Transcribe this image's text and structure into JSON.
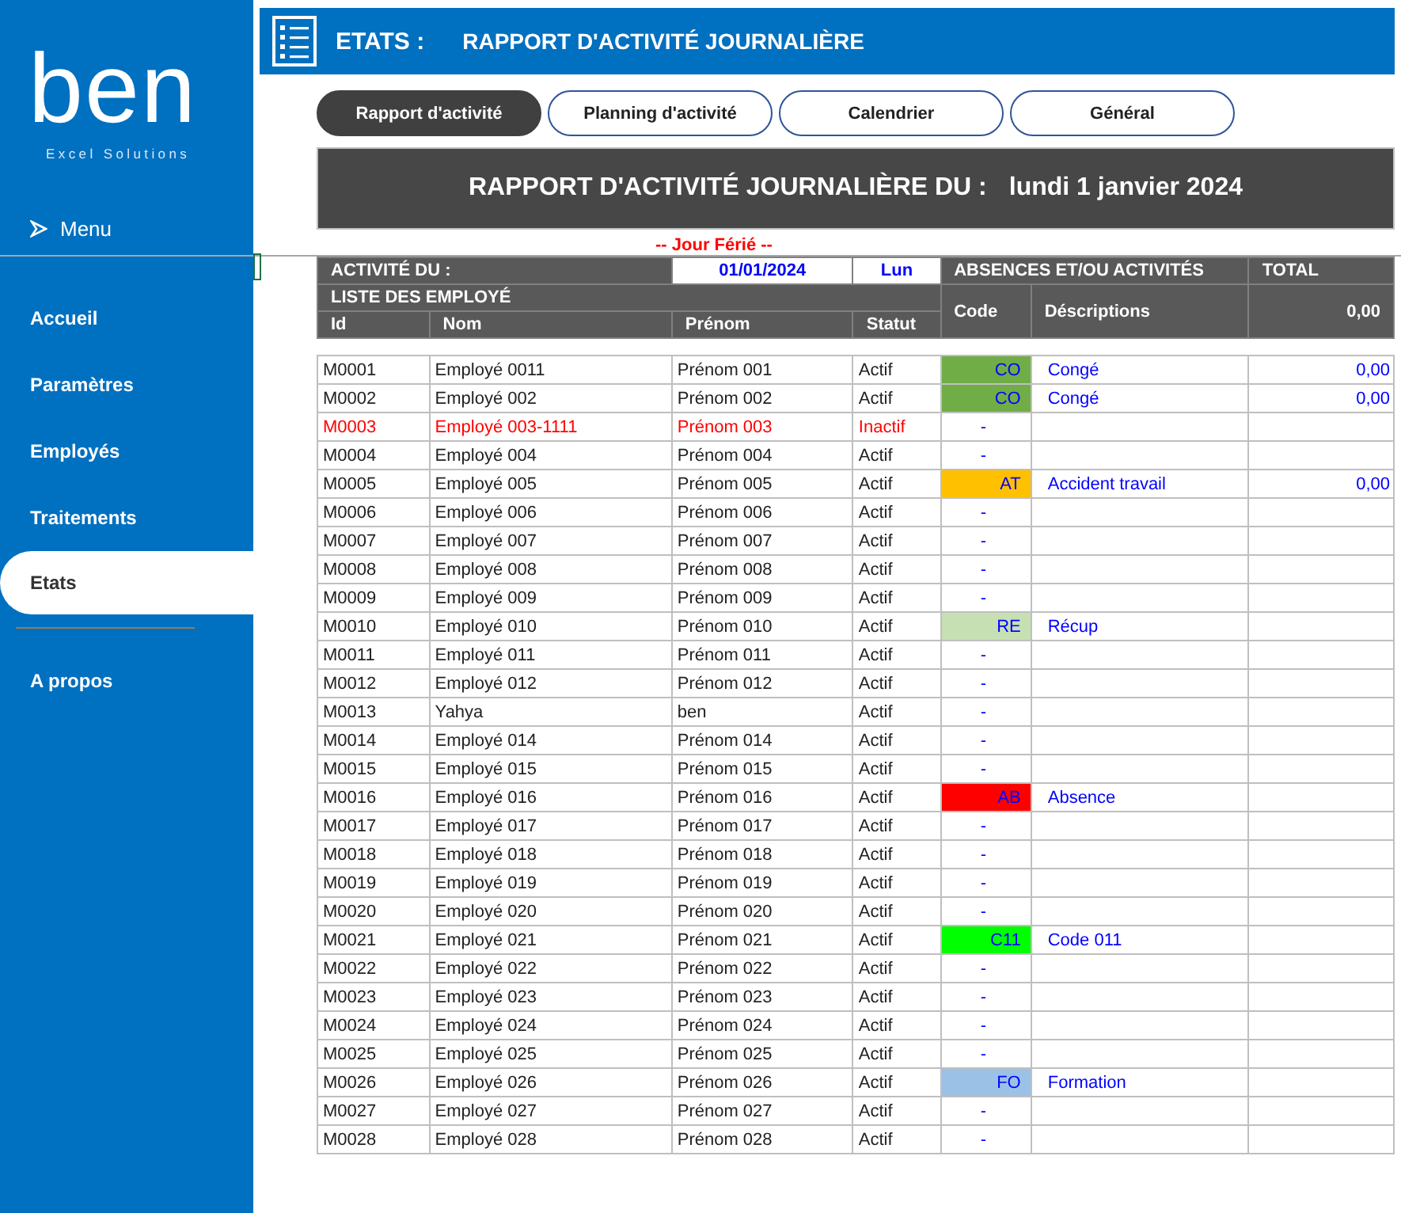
{
  "sidebar": {
    "logo": "ben",
    "tagline": "Excel Solutions",
    "menu_label": "Menu",
    "items": [
      {
        "label": "Accueil",
        "selected": false
      },
      {
        "label": "Paramètres",
        "selected": false
      },
      {
        "label": "Employés",
        "selected": false
      },
      {
        "label": "Traitements",
        "selected": false
      },
      {
        "label": "Etats",
        "selected": true
      },
      {
        "label": "A propos",
        "selected": false
      }
    ]
  },
  "header": {
    "section": "ETATS :",
    "title": "RAPPORT D'ACTIVITÉ JOURNALIÈRE"
  },
  "tabs": [
    {
      "label": "Rapport d'activité",
      "selected": true
    },
    {
      "label": "Planning d'activité",
      "selected": false
    },
    {
      "label": "Calendrier",
      "selected": false
    },
    {
      "label": "Général",
      "selected": false
    }
  ],
  "banner": {
    "label": "RAPPORT D'ACTIVITÉ JOURNALIÈRE DU :",
    "date": "lundi 1 janvier 2024"
  },
  "report": {
    "holiday_note": "-- Jour Férié --",
    "activity_label": "ACTIVITÉ DU :",
    "date": "01/01/2024",
    "day": "Lun",
    "employees_label": "LISTE DES EMPLOYÉ",
    "absences_label": "ABSENCES ET/OU ACTIVITÉS",
    "total_label": "TOTAL",
    "total": "0,00",
    "columns": [
      "Id",
      "Nom",
      "Prénom",
      "Statut",
      "Code",
      "Déscriptions"
    ]
  },
  "rows": [
    {
      "id": "M0001",
      "nom": "Employé 0011",
      "prenom": "Prénom 001",
      "statut": "Actif",
      "inactive": false,
      "code": "CO",
      "color": "#70ad47",
      "description": "Congé",
      "total": "0,00"
    },
    {
      "id": "M0002",
      "nom": "Employé 002",
      "prenom": "Prénom 002",
      "statut": "Actif",
      "inactive": false,
      "code": "CO",
      "color": "#70ad47",
      "description": "Congé",
      "total": "0,00"
    },
    {
      "id": "M0003",
      "nom": "Employé 003-1111",
      "prenom": "Prénom 003",
      "statut": "Inactif",
      "inactive": true,
      "code": "-"
    },
    {
      "id": "M0004",
      "nom": "Employé 004",
      "prenom": "Prénom 004",
      "statut": "Actif",
      "inactive": false,
      "code": "-"
    },
    {
      "id": "M0005",
      "nom": "Employé 005",
      "prenom": "Prénom 005",
      "statut": "Actif",
      "inactive": false,
      "code": "AT",
      "color": "#ffc000",
      "description": "Accident travail",
      "total": "0,00"
    },
    {
      "id": "M0006",
      "nom": "Employé 006",
      "prenom": "Prénom 006",
      "statut": "Actif",
      "inactive": false,
      "code": "-"
    },
    {
      "id": "M0007",
      "nom": "Employé 007",
      "prenom": "Prénom 007",
      "statut": "Actif",
      "inactive": false,
      "code": "-"
    },
    {
      "id": "M0008",
      "nom": "Employé 008",
      "prenom": "Prénom 008",
      "statut": "Actif",
      "inactive": false,
      "code": "-"
    },
    {
      "id": "M0009",
      "nom": "Employé 009",
      "prenom": "Prénom 009",
      "statut": "Actif",
      "inactive": false,
      "code": "-"
    },
    {
      "id": "M0010",
      "nom": "Employé 010",
      "prenom": "Prénom 010",
      "statut": "Actif",
      "inactive": false,
      "code": "RE",
      "color": "#c6e0b4",
      "description": "Récup"
    },
    {
      "id": "M0011",
      "nom": "Employé 011",
      "prenom": "Prénom 011",
      "statut": "Actif",
      "inactive": false,
      "code": "-"
    },
    {
      "id": "M0012",
      "nom": "Employé 012",
      "prenom": "Prénom 012",
      "statut": "Actif",
      "inactive": false,
      "code": "-"
    },
    {
      "id": "M0013",
      "nom": "Yahya",
      "prenom": "ben",
      "statut": "Actif",
      "inactive": false,
      "code": "-"
    },
    {
      "id": "M0014",
      "nom": "Employé 014",
      "prenom": "Prénom 014",
      "statut": "Actif",
      "inactive": false,
      "code": "-"
    },
    {
      "id": "M0015",
      "nom": "Employé 015",
      "prenom": "Prénom 015",
      "statut": "Actif",
      "inactive": false,
      "code": "-"
    },
    {
      "id": "M0016",
      "nom": "Employé 016",
      "prenom": "Prénom 016",
      "statut": "Actif",
      "inactive": false,
      "code": "AB",
      "color": "#ff0000",
      "description": "Absence"
    },
    {
      "id": "M0017",
      "nom": "Employé 017",
      "prenom": "Prénom 017",
      "statut": "Actif",
      "inactive": false,
      "code": "-"
    },
    {
      "id": "M0018",
      "nom": "Employé 018",
      "prenom": "Prénom 018",
      "statut": "Actif",
      "inactive": false,
      "code": "-"
    },
    {
      "id": "M0019",
      "nom": "Employé 019",
      "prenom": "Prénom 019",
      "statut": "Actif",
      "inactive": false,
      "code": "-"
    },
    {
      "id": "M0020",
      "nom": "Employé 020",
      "prenom": "Prénom 020",
      "statut": "Actif",
      "inactive": false,
      "code": "-"
    },
    {
      "id": "M0021",
      "nom": "Employé 021",
      "prenom": "Prénom 021",
      "statut": "Actif",
      "inactive": false,
      "code": "C11",
      "color": "#00ff00",
      "description": "Code 011"
    },
    {
      "id": "M0022",
      "nom": "Employé 022",
      "prenom": "Prénom 022",
      "statut": "Actif",
      "inactive": false,
      "code": "-"
    },
    {
      "id": "M0023",
      "nom": "Employé 023",
      "prenom": "Prénom 023",
      "statut": "Actif",
      "inactive": false,
      "code": "-"
    },
    {
      "id": "M0024",
      "nom": "Employé 024",
      "prenom": "Prénom 024",
      "statut": "Actif",
      "inactive": false,
      "code": "-"
    },
    {
      "id": "M0025",
      "nom": "Employé 025",
      "prenom": "Prénom 025",
      "statut": "Actif",
      "inactive": false,
      "code": "-"
    },
    {
      "id": "M0026",
      "nom": "Employé 026",
      "prenom": "Prénom 026",
      "statut": "Actif",
      "inactive": false,
      "code": "FO",
      "color": "#9bc2e6",
      "description": "Formation"
    },
    {
      "id": "M0027",
      "nom": "Employé 027",
      "prenom": "Prénom 027",
      "statut": "Actif",
      "inactive": false,
      "code": "-"
    },
    {
      "id": "M0028",
      "nom": "Employé 028",
      "prenom": "Prénom 028",
      "statut": "Actif",
      "inactive": false,
      "code": "-"
    }
  ]
}
